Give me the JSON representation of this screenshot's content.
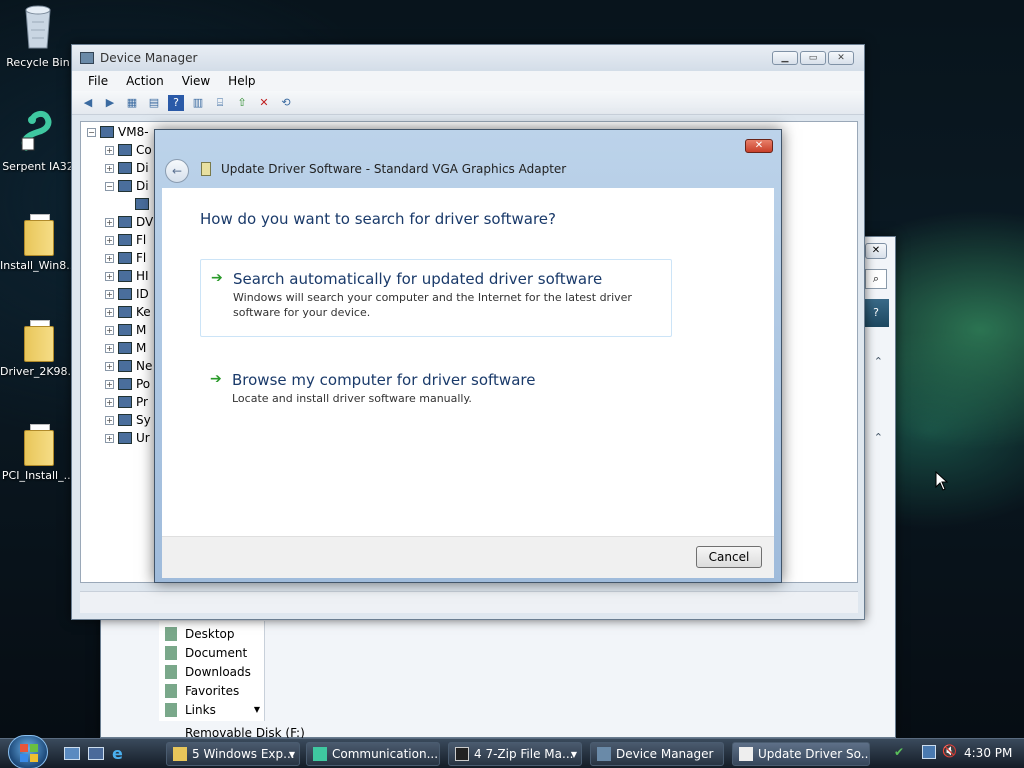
{
  "desktop_icons": [
    {
      "label": "Recycle Bin",
      "icon": "recycle-bin-icon"
    },
    {
      "label": "Serpent IA32",
      "icon": "serpent-icon"
    },
    {
      "label": "Install_Win8...",
      "icon": "folder-icon"
    },
    {
      "label": "Driver_2K98...",
      "icon": "folder-icon"
    },
    {
      "label": "PCI_Install_...",
      "icon": "folder-icon"
    }
  ],
  "device_manager": {
    "title": "Device Manager",
    "menu": [
      "File",
      "Action",
      "View",
      "Help"
    ],
    "root_label": "VM8-",
    "tree_rows": [
      "Co",
      "Di",
      "Di",
      "",
      "DV",
      "Fl",
      "Fl",
      "HI",
      "ID",
      "Ke",
      "M",
      "M",
      "Ne",
      "Po",
      "Pr",
      "Sy",
      "Ur"
    ]
  },
  "explorer_bg": {
    "nav_items": [
      "Desktop",
      "Document",
      "Downloads",
      "Favorites",
      "Links"
    ],
    "status_text": "Removable Disk (F:)"
  },
  "dialog": {
    "title": "Update Driver Software - Standard VGA Graphics Adapter",
    "question": "How do you want to search for driver software?",
    "option1_heading": "Search automatically for updated driver software",
    "option1_desc": "Windows will search your computer and the Internet for the latest driver software for your device.",
    "option2_heading": "Browse my computer for driver software",
    "option2_desc": "Locate and install driver software manually.",
    "cancel_label": "Cancel"
  },
  "taskbar": {
    "buttons": [
      {
        "label": "5 Windows Exp...",
        "active": false
      },
      {
        "label": "Communication...",
        "active": false
      },
      {
        "label": "4 7-Zip File Ma...",
        "active": false
      },
      {
        "label": "Device Manager",
        "active": false
      },
      {
        "label": "Update Driver So...",
        "active": true
      }
    ],
    "clock": "4:30 PM"
  },
  "colors": {
    "accent": "#1a3a6a",
    "arrow_green": "#2a9a2a",
    "close_red": "#c8402a"
  }
}
